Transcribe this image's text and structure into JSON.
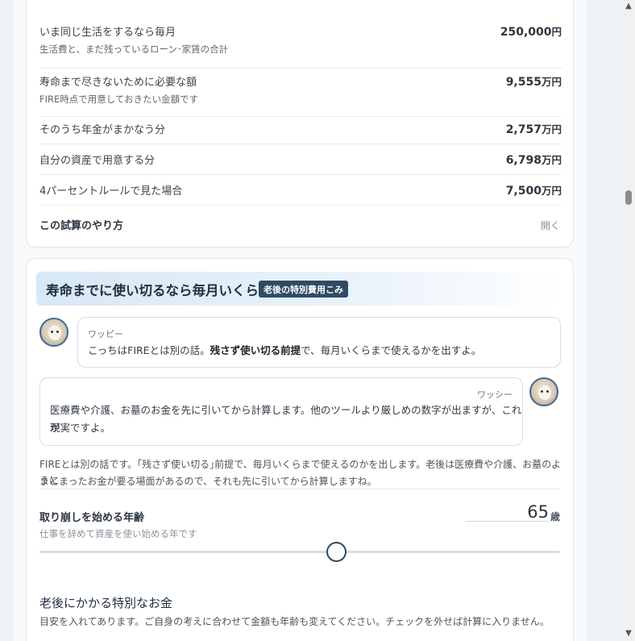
{
  "summary": {
    "rows": [
      {
        "label": "いま同じ生活をするなら毎月",
        "sub": "生活費と、まだ残っているローン･家賃の合計",
        "value": "250,000",
        "unit": "円"
      },
      {
        "label": "寿命まで尽きないために必要な額",
        "sub": "FIRE時点で用意しておきたい金額です",
        "value": "9,555",
        "unit": "万円"
      },
      {
        "label": "そのうち年金がまかなう分",
        "sub": "",
        "value": "2,757",
        "unit": "万円"
      },
      {
        "label": "自分の資産で用意する分",
        "sub": "",
        "value": "6,798",
        "unit": "万円"
      },
      {
        "label": "4パーセントルールで見た場合",
        "sub": "",
        "value": "7,500",
        "unit": "万円"
      }
    ],
    "howto_label": "この試算のやり方",
    "open_label": "開く"
  },
  "spend": {
    "title": "寿命までに使い切るなら毎月いくら",
    "badge": "老後の特別費用こみ",
    "chat1": {
      "name": "ワッピー",
      "text_a": "こっちはFIREとは別の話。",
      "text_b": "残さず使い切る前提",
      "text_c": "で、毎月いくらまで使えるかを出すよ。"
    },
    "chat2": {
      "name": "ワッシー",
      "line1": "医療費や介護、お墓のお金を先に引いてから計算します。他のツールより厳しめの数字が出ますが、これが",
      "line2": "現実ですよ。"
    },
    "desc_line1": "FIREとは別の話です。｢残さず使い切る｣前提で、毎月いくらまで使えるのかを出します。老後は医療費や介護、お墓のように",
    "desc_line2": "まとまったお金が要る場面があるので、それも先に引いてから計算しますね。",
    "age": {
      "label": "取り崩しを始める年齢",
      "sub": "仕事を辞めて資産を使い始める年です",
      "value": "65",
      "unit": "歳",
      "slider_fraction": 0.57
    },
    "special": {
      "heading": "老後にかかる特別なお金",
      "desc": "目安を入れてあります。ご自身の考えに合わせて金額も年齢も変えてください。チェックを外せば計算に入りません。"
    }
  },
  "colors": {
    "accent": "#2f4a66",
    "header_gradient_start": "#d8e8f5"
  },
  "icons": {
    "scroll_up": "▲",
    "scroll_down": "▼"
  }
}
